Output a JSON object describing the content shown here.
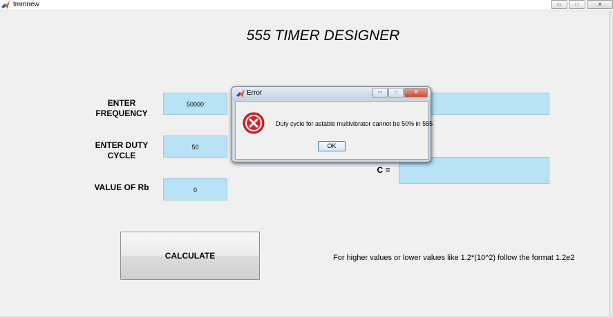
{
  "window": {
    "title": "tmmnew",
    "controls": [
      "▭",
      "□",
      "✕"
    ]
  },
  "page_title": "555 TIMER DESIGNER",
  "labels": {
    "frequency": "ENTER\nFREQUENCY",
    "duty_cycle": "ENTER DUTY\nCYCLE",
    "rb": "VALUE OF Rb",
    "c": "C ="
  },
  "fields": {
    "frequency": "50000",
    "duty_cycle": "50",
    "rb": "0",
    "output_top": "",
    "c_output": ""
  },
  "calculate_button": "CALCULATE",
  "hint": "For higher values or lower values like 1.2*(10^2) follow the format    1.2e2",
  "dialog": {
    "title": "Error",
    "message": "Duty cycle for astable multivibrator cannot be 50% in 555",
    "ok_label": "OK",
    "controls": [
      "▭",
      "□",
      "✕"
    ]
  },
  "colors": {
    "field_bg": "#b8e2f5",
    "error_red": "#d9232a",
    "background": "#f0f0f0"
  }
}
